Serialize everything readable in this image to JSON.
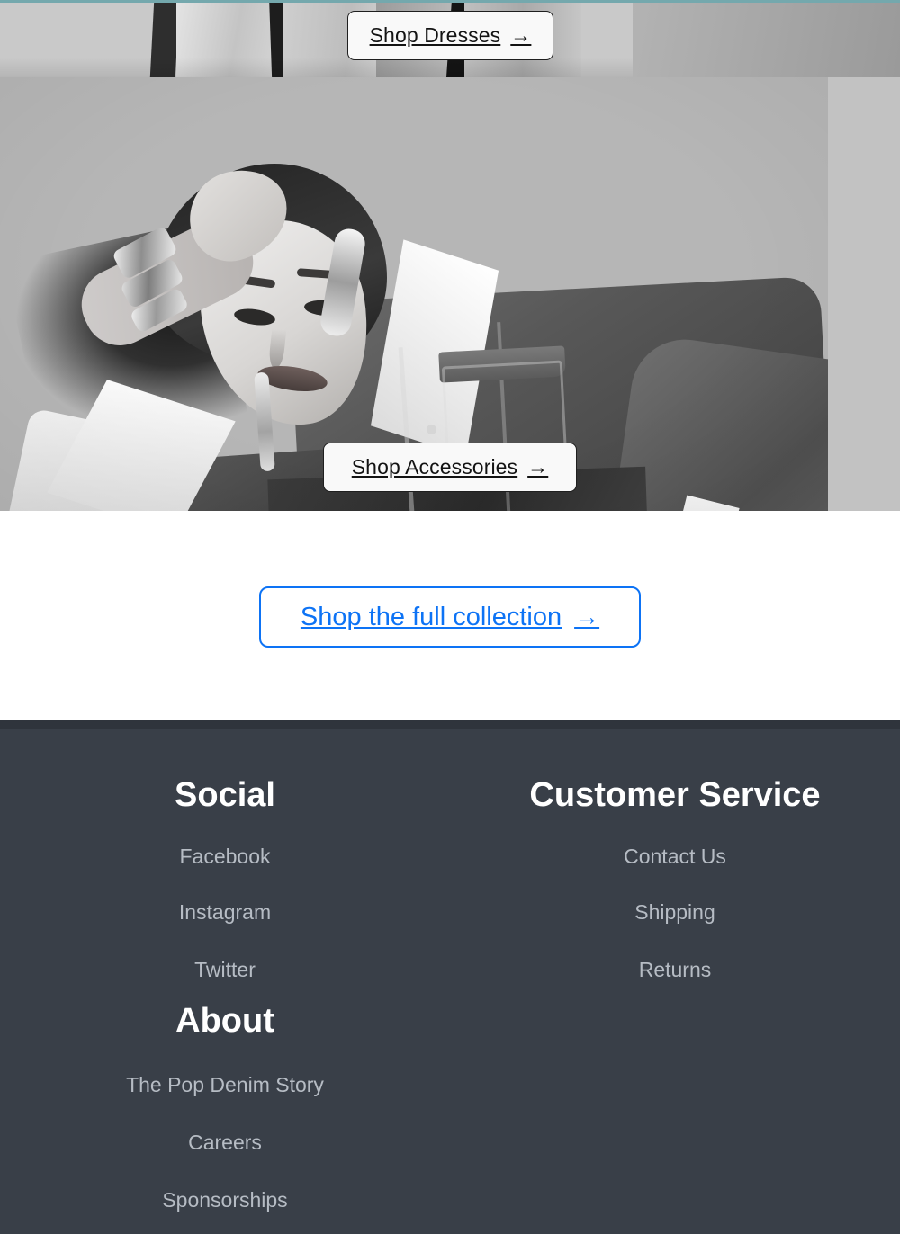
{
  "theme": {
    "accent_rule_color": "#74a8ad",
    "link_blue": "#0d73f5",
    "footer_bg": "#393f48",
    "footer_heading_color": "#ffffff",
    "footer_link_color": "#b6bcc4",
    "cta_light_bg": "#f9f9f9",
    "cta_light_border": "#1f1f1f"
  },
  "hero": {
    "dresses_cta": {
      "label": "Shop Dresses",
      "arrow": "→",
      "icon": "arrow-right-icon"
    },
    "accessories_cta": {
      "label": "Shop Accessories",
      "arrow": "→",
      "icon": "arrow-right-icon"
    }
  },
  "collection": {
    "cta": {
      "label": "Shop the full collection",
      "arrow": "→",
      "icon": "arrow-right-icon"
    }
  },
  "footer": {
    "columns": [
      {
        "heading": "Social",
        "links": [
          {
            "label": "Facebook"
          },
          {
            "label": "Instagram"
          },
          {
            "label": "Twitter"
          }
        ]
      },
      {
        "heading": "Customer Service",
        "links": [
          {
            "label": "Contact Us"
          },
          {
            "label": "Shipping"
          },
          {
            "label": "Returns"
          }
        ]
      }
    ],
    "about": {
      "heading": "About",
      "links": [
        {
          "label": "The Pop Denim Story"
        },
        {
          "label": "Careers"
        },
        {
          "label": "Sponsorships"
        }
      ]
    }
  }
}
